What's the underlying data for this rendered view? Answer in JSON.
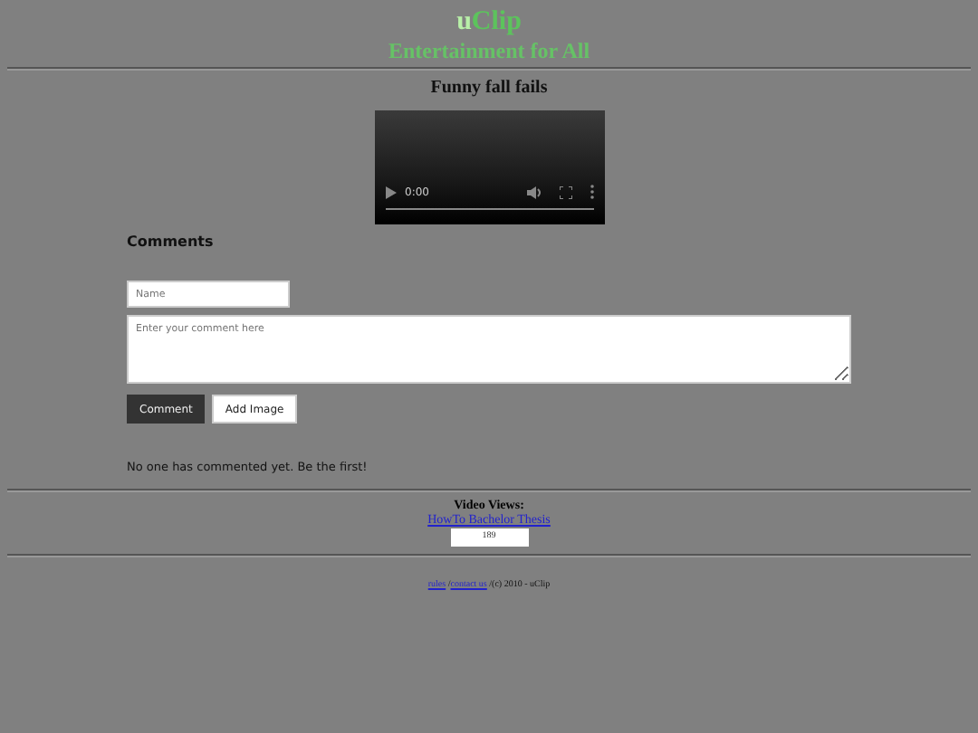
{
  "logo": {
    "prefix": "u",
    "main": "Clip"
  },
  "tagline": "Entertainment for All",
  "video": {
    "title": "Funny fall fails",
    "time": "0:00"
  },
  "comments": {
    "heading": "Comments",
    "name_placeholder": "Name",
    "comment_placeholder": "Enter your comment here",
    "buttons": [
      {
        "label": "Comment",
        "kind": "primary"
      },
      {
        "label": "Add Image",
        "kind": "secondary"
      }
    ],
    "empty_message": "No one has commented yet. Be the first!"
  },
  "views": {
    "label": "Video Views:",
    "link": "HowTo Bachelor Thesis",
    "count": "189"
  },
  "footer": {
    "links": [
      "rules",
      "contact us"
    ],
    "separator": "/",
    "text": "(c) 2010 - uClip"
  }
}
